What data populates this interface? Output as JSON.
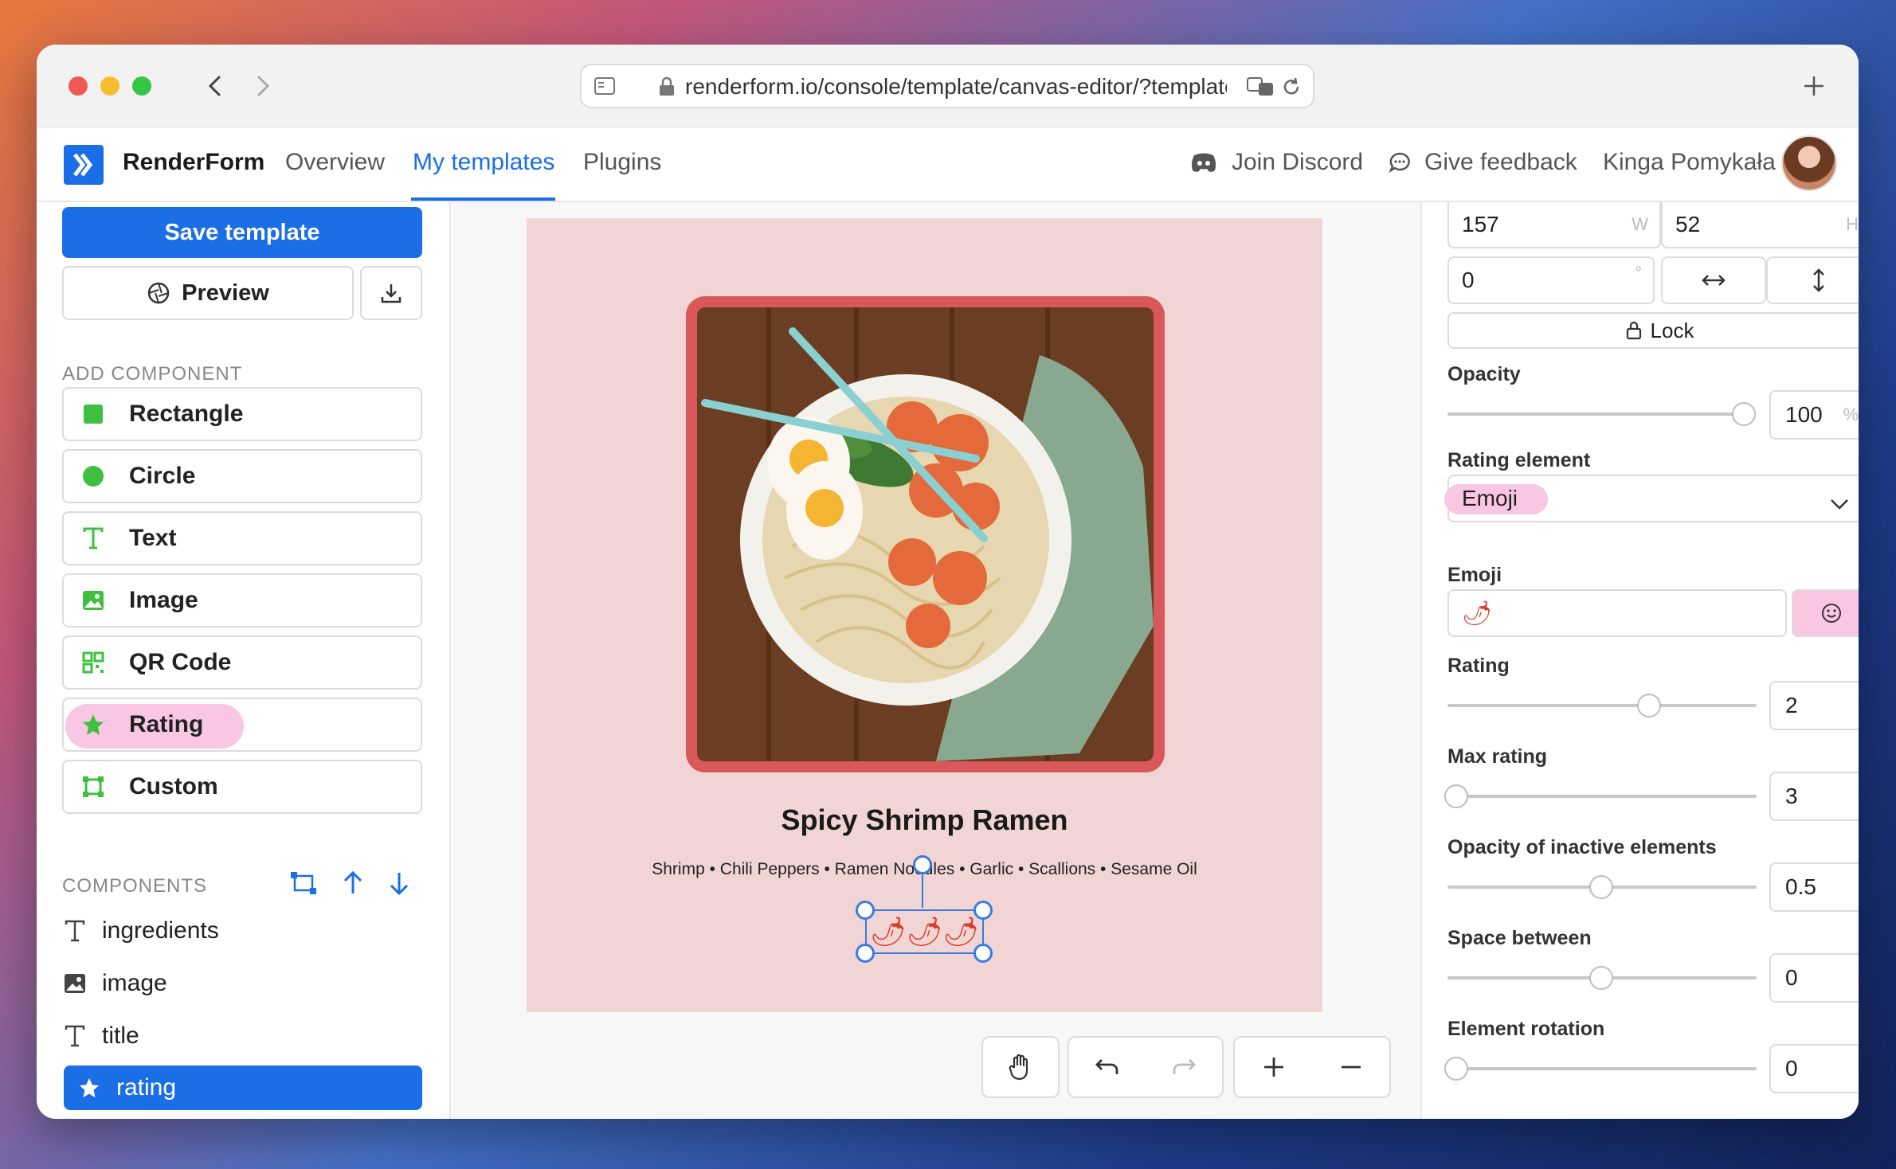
{
  "browser": {
    "url": "renderform.io/console/template/canvas-editor/?template"
  },
  "app": {
    "brand": "RenderForm",
    "nav": [
      "Overview",
      "My templates",
      "Plugins"
    ],
    "discord": "Join Discord",
    "feedback": "Give feedback",
    "user": "Kinga Pomykała"
  },
  "sidebar": {
    "save": "Save template",
    "preview": "Preview",
    "add_component_label": "ADD COMPONENT",
    "add_components": [
      "Rectangle",
      "Circle",
      "Text",
      "Image",
      "QR Code",
      "Rating",
      "Custom"
    ],
    "components_label": "COMPONENTS",
    "layers": [
      "ingredients",
      "image",
      "title",
      "rating"
    ]
  },
  "canvas": {
    "title": "Spicy Shrimp Ramen",
    "ingredients": "Shrimp • Chili Peppers • Ramen Noodles • Garlic • Scallions • Sesame Oil",
    "rating_emoji": "🌶🌶🌶"
  },
  "props": {
    "width": "157",
    "width_suffix": "W",
    "height": "52",
    "height_suffix": "H",
    "rotation": "0",
    "rotation_suffix": "°",
    "lock": "Lock",
    "opacity_label": "Opacity",
    "opacity": "100",
    "opacity_suffix": "%",
    "rating_element_label": "Rating element",
    "rating_element": "Emoji",
    "emoji_label": "Emoji",
    "emoji": "🌶",
    "rating_label": "Rating",
    "rating": "2",
    "max_rating_label": "Max rating",
    "max_rating": "3",
    "inactive_opacity_label": "Opacity of inactive elements",
    "inactive_opacity": "0.5",
    "space_label": "Space between",
    "space": "0",
    "rotation_label": "Element rotation",
    "element_rotation": "0"
  },
  "colors": {
    "accent": "#1a6ee6",
    "artboard": "#f1d4d4",
    "frame": "#d9585a",
    "component_icon": "#3fbf3f",
    "highlight": "#f9c7e4"
  }
}
